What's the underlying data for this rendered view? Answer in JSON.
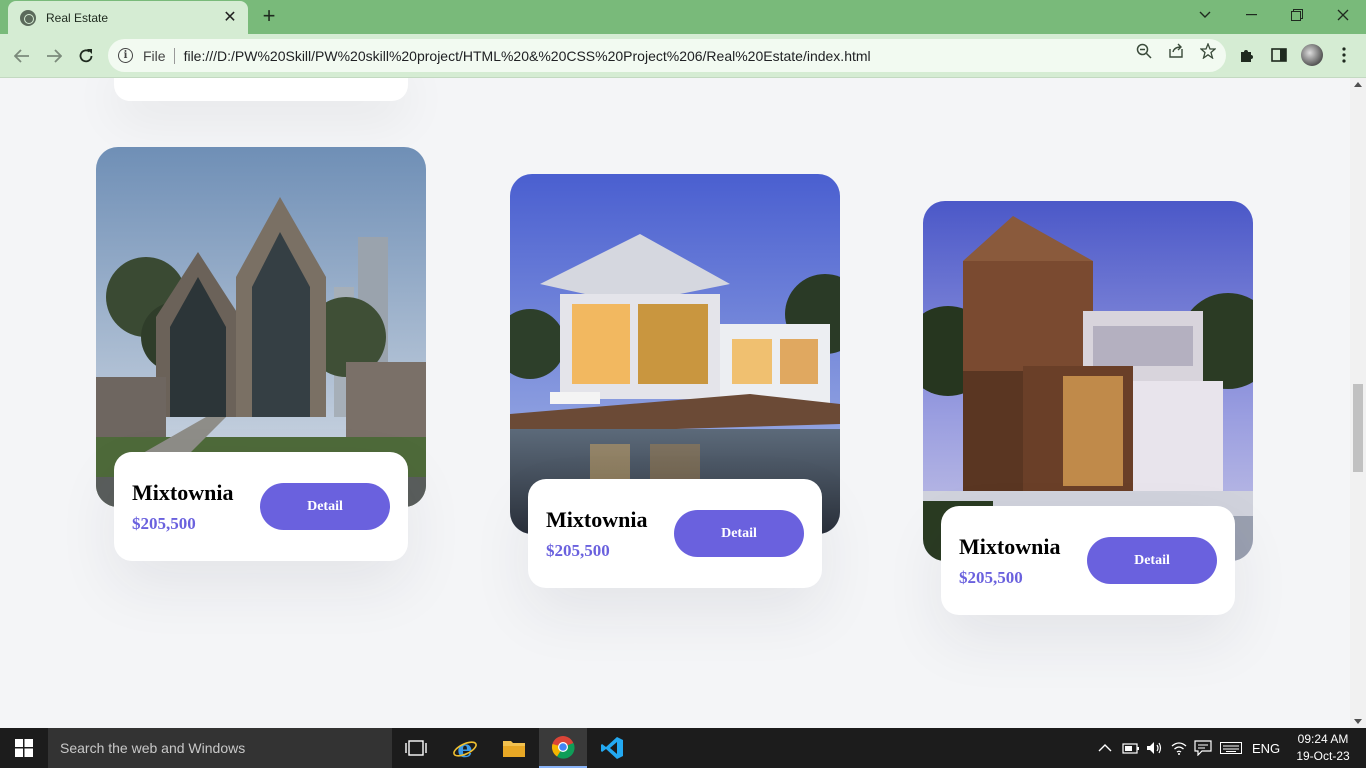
{
  "browser": {
    "tab_title": "Real Estate",
    "tab_close": "✕",
    "new_tab": "+",
    "scheme_label": "File",
    "url": "file:///D:/PW%20Skill/PW%20skill%20project/HTML%20&%20CSS%20Project%206/Real%20Estate/index.html"
  },
  "cards": [
    {
      "name": "Mixtownia",
      "price": "$205,500",
      "button": "Detail"
    },
    {
      "name": "Mixtownia",
      "price": "$205,500",
      "button": "Detail"
    },
    {
      "name": "Mixtownia",
      "price": "$205,500",
      "button": "Detail"
    }
  ],
  "taskbar": {
    "search_placeholder": "Search the web and Windows",
    "language": "ENG",
    "time": "09:24 AM",
    "date": "19-Oct-23"
  },
  "colors": {
    "accent": "#6a61de",
    "chrome_frame": "#79ba7a",
    "chrome_toolbar": "#d5ecd3",
    "page_bg": "#f4f5f7"
  }
}
